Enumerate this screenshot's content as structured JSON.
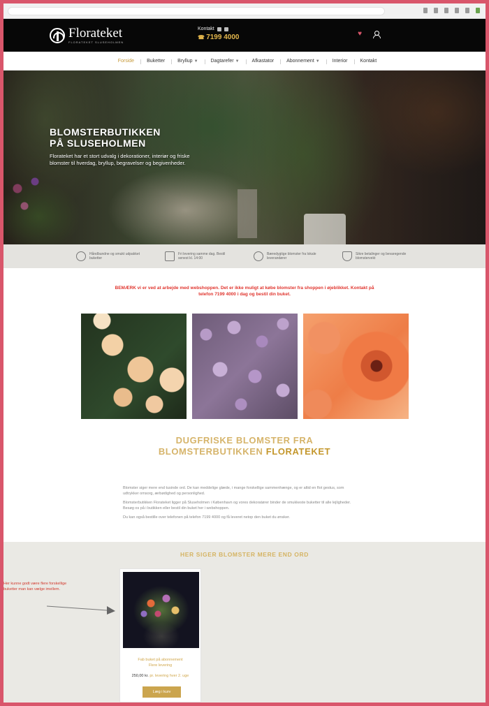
{
  "header": {
    "logo_name": "Florateket",
    "logo_tagline": "FLORATEKET SLUSEHOLMEN",
    "contact_label": "Kontakt",
    "phone": "7199 4000"
  },
  "nav": {
    "items": [
      {
        "label": "Forside",
        "active": true,
        "has_dropdown": false
      },
      {
        "label": "Buketter",
        "active": false,
        "has_dropdown": false
      },
      {
        "label": "Bryllup",
        "active": false,
        "has_dropdown": true
      },
      {
        "label": "Dagtarefer",
        "active": false,
        "has_dropdown": true
      },
      {
        "label": "Afkastator",
        "active": false,
        "has_dropdown": false
      },
      {
        "label": "Abonnement",
        "active": false,
        "has_dropdown": true
      },
      {
        "label": "Interior",
        "active": false,
        "has_dropdown": false
      },
      {
        "label": "Kontakt",
        "active": false,
        "has_dropdown": false
      }
    ]
  },
  "hero": {
    "title_line1": "BLOMSTERBUTIKKEN",
    "title_line2": "PÅ SLUSEHOLMEN",
    "body": "Florateket har et stort udvalg i dekorationer, interiør og friske blomster til hverdag, bryllup, begravelser og begivenheder."
  },
  "features": [
    {
      "icon": "flower-icon",
      "text": "Håndbundne og smukt udpakket buketter"
    },
    {
      "icon": "delivery-icon",
      "text": "Fri levering samme dag. Bestil senest kl. 14:00"
    },
    {
      "icon": "leaf-icon",
      "text": "Bæredygtige blomster fra lokale leverandører"
    },
    {
      "icon": "shield-icon",
      "text": "Sikre betalinger og bevaregende blomstervekt"
    }
  ],
  "notice": "BEMÆRK vi er ved at arbejde med webshoppen. Det er ikke muligt at købe blomster fra shoppen i øjeblikket. Kontakt på telefon 7199 4000 i dag og bestil din buket.",
  "tiles": [
    {
      "name": "roses"
    },
    {
      "name": "lilac"
    },
    {
      "name": "gerbera"
    }
  ],
  "section": {
    "heading_line1": "DUGFRISKE BLOMSTER FRA",
    "heading_line2_light": "BLOMSTERBUTIKKEN",
    "heading_line2_strong": "FLORATEKET"
  },
  "intro": {
    "p1": "Blomster siger mere end tusinde ord. De kan meddelige glæde, i mange forskellige sammenhænge, og er altid en flot gestus, som udtrykker omsorg, ærbødighed og personlighed.",
    "p2": "Blomsterbutikken Florateket ligger på Sluseholmen i København og vores dekoratører binder de smukkeste buketter til alle lejligheder. Besøg os på i butikken eller bestil din buket her i webshoppen.",
    "p3": "Du kan også bestille over telefonen på telefon 7199 4000 og få leveret netop den buket du ønsker."
  },
  "bottom": {
    "heading": "HER SIGER BLOMSTER MERE END ORD",
    "annotation": "Her kunne godt være flere forskellige buketter man kan vælge imellem.",
    "product": {
      "title_line1": "Fab buket på abonnement",
      "title_line2": "Flere levering",
      "price": "250,00 kr.",
      "price_sub": "pr. levering hver 2. uge",
      "button_label": "Læg i kurv"
    }
  }
}
